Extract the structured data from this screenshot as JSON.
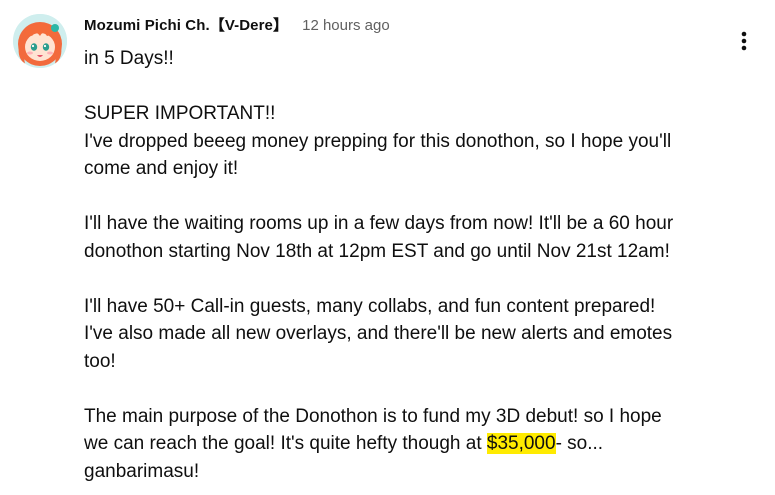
{
  "comment": {
    "author": "Mozumi Pichi Ch.【V-Dere】",
    "timestamp": "12 hours ago",
    "line1": "in 5 Days!!",
    "line2": "SUPER IMPORTANT!!",
    "line3": "I've dropped beeeg money prepping for this donothon, so I hope you'll",
    "line4": "come and enjoy it!",
    "line5": "I'll have the waiting rooms up in a few days from now! It'll be a 60 hour",
    "line6": "donothon starting Nov 18th at 12pm EST and go until Nov 21st 12am!",
    "line7": "I'll have 50+ Call-in guests, many collabs, and fun content prepared!",
    "line8": "I've also made all new overlays, and there'll be new alerts and emotes",
    "line9": "too!",
    "line10_before": "The main purpose of the Donothon is to fund my 3D debut! so I hope",
    "line11_before": "we can reach the goal! It's quite hefty though at ",
    "line11_highlight": "$35,000",
    "line11_after": "- so...",
    "line12": "ganbarimasu!"
  },
  "icons": {
    "avatar": "vtuber-avatar",
    "menu": "more-vert-icon"
  },
  "colors": {
    "text": "#0f0f0f",
    "secondary": "#606060",
    "highlight": "#ffeb00"
  }
}
